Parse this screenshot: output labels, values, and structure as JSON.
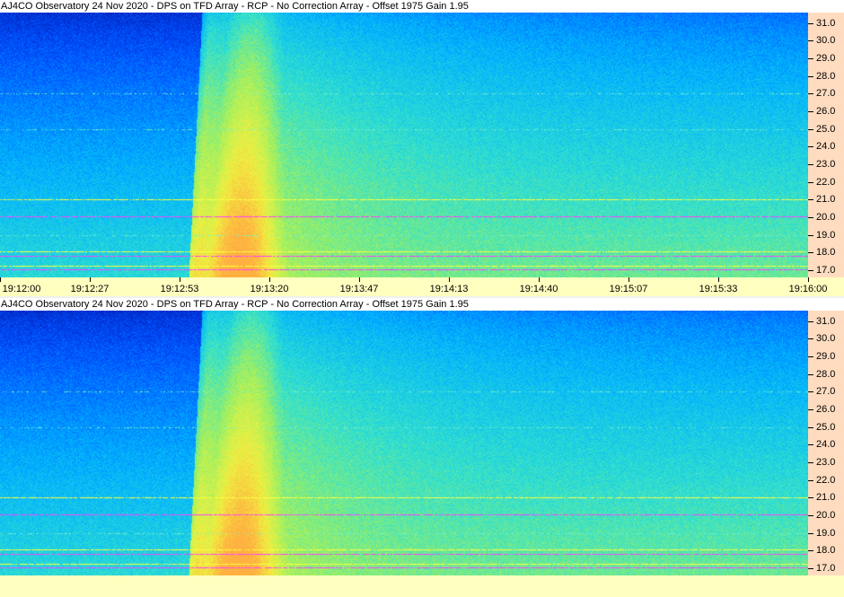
{
  "chart_data": [
    {
      "type": "heatmap",
      "title": "AJ4CO Observatory 24 Nov 2020 - DPS on TFD Array  - RCP  -  No Correction Array  -  Offset 1975  Gain 1.95",
      "x_ticks": [
        "19:12:00",
        "19:12:27",
        "19:12:53",
        "19:13:20",
        "19:13:47",
        "19:14:13",
        "19:14:40",
        "19:15:07",
        "19:15:33",
        "19:16:00"
      ],
      "y_ticks": [
        "31.0",
        "30.0",
        "29.0",
        "28.0",
        "27.0",
        "26.0",
        "25.0",
        "24.0",
        "23.0",
        "22.0",
        "21.0",
        "20.0",
        "19.0",
        "18.0",
        "17.0"
      ],
      "ylim": [
        16.6,
        31.6
      ],
      "xlim": [
        "19:12:00",
        "19:16:00"
      ],
      "colormap": [
        "#000018",
        "#0010a0",
        "#0050ff",
        "#00b0ff",
        "#30e0d0",
        "#a0f060",
        "#f0f040",
        "#ffb040"
      ],
      "show_x_labels": true
    },
    {
      "type": "heatmap",
      "title": "AJ4CO Observatory 24 Nov 2020 - DPS on TFD Array  - RCP  -  No Correction Array  -  Offset 1975  Gain 1.95",
      "x_ticks": [],
      "y_ticks": [
        "31.0",
        "30.0",
        "29.0",
        "28.0",
        "27.0",
        "26.0",
        "25.0",
        "24.0",
        "23.0",
        "22.0",
        "21.0",
        "20.0",
        "19.0",
        "18.0",
        "17.0"
      ],
      "ylim": [
        16.6,
        31.6
      ],
      "colormap": [
        "#000018",
        "#0010a0",
        "#0050ff",
        "#00b0ff",
        "#30e0d0",
        "#a0f060",
        "#f0f040",
        "#ffb040"
      ],
      "show_x_labels": false
    }
  ],
  "colors": {
    "axis_bg": "#ffdcc0",
    "time_bar_bg": "#ffffc0",
    "interference_magenta": "#ff40ff",
    "interference_yellow": "#ffff40"
  }
}
